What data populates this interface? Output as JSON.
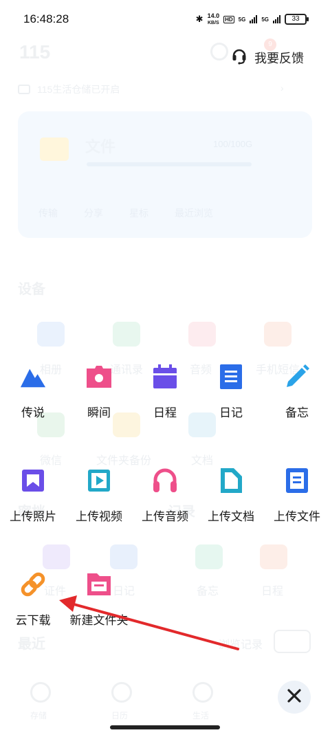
{
  "status_bar": {
    "time": "16:48:28",
    "net_speed": "14.0",
    "net_unit": "KB/S",
    "hd": "HD",
    "sim1": "5G",
    "sim2": "5G",
    "battery": "33"
  },
  "background": {
    "logo": "115",
    "badge": "9",
    "notice": "115生活仓储已开启",
    "file_title": "文件",
    "file_meta": "100/100G",
    "card_actions": [
      "传输",
      "分享",
      "星标",
      "最近浏览"
    ],
    "sections": {
      "devices": "设备",
      "archive": "密档",
      "records": "记录",
      "recent": "最近"
    },
    "device_items": [
      "相册",
      "通讯录",
      "音频",
      "手机短信"
    ],
    "device_items2": [
      "微信",
      "文件夹备份",
      "文档"
    ],
    "archive_items": [
      "证件",
      "日记",
      "备忘",
      "日程"
    ],
    "recent_action": "浏览记录",
    "tabbar": [
      "存储",
      "日历",
      "生活"
    ]
  },
  "feedback": {
    "label": "我要反馈"
  },
  "actions_row1": [
    {
      "label": "传说",
      "icon": "mountain-icon",
      "color": "#2b6de8"
    },
    {
      "label": "瞬间",
      "icon": "camera-icon",
      "color": "#ee4f8a"
    },
    {
      "label": "日程",
      "icon": "calendar-icon",
      "color": "#6a4ee8"
    },
    {
      "label": "日记",
      "icon": "notes-icon",
      "color": "#2b6de8"
    },
    {
      "label": "备忘",
      "icon": "pencil-icon",
      "color": "#2aa3e8"
    }
  ],
  "actions_row2": [
    {
      "label": "上传照片",
      "icon": "photo-icon",
      "color": "#6a4ee8"
    },
    {
      "label": "上传视频",
      "icon": "video-icon",
      "color": "#22a8c8"
    },
    {
      "label": "上传音频",
      "icon": "headphones-icon",
      "color": "#ee4f8a"
    },
    {
      "label": "上传文档",
      "icon": "document-icon",
      "color": "#22a8c8"
    },
    {
      "label": "上传文件",
      "icon": "file-icon",
      "color": "#2b6de8"
    }
  ],
  "actions_row3": [
    {
      "label": "云下载",
      "icon": "link-icon",
      "color": "#f5922a"
    },
    {
      "label": "新建文件夹",
      "icon": "folder-icon",
      "color": "#ee4f8a"
    }
  ],
  "colors": {
    "accent_blue": "#2b6de8",
    "arrow_red": "#e2292b",
    "close_bg": "#edf2f8"
  }
}
